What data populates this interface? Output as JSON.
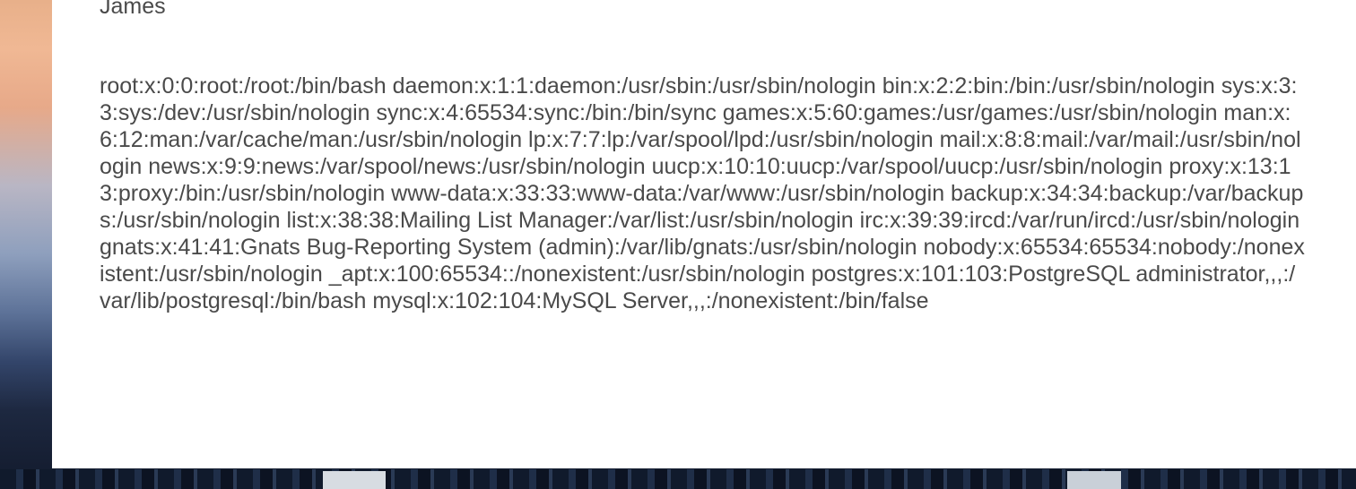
{
  "author_name": "James",
  "comment_body": "root:x:0:0:root:/root:/bin/bash daemon:x:1:1:daemon:/usr/sbin:/usr/sbin/nologin bin:x:2:2:bin:/bin:/usr/sbin/nologin sys:x:3:3:sys:/dev:/usr/sbin/nologin sync:x:4:65534:sync:/bin:/bin/sync games:x:5:60:games:/usr/games:/usr/sbin/nologin man:x:6:12:man:/var/cache/man:/usr/sbin/nologin lp:x:7:7:lp:/var/spool/lpd:/usr/sbin/nologin mail:x:8:8:mail:/var/mail:/usr/sbin/nologin news:x:9:9:news:/var/spool/news:/usr/sbin/nologin uucp:x:10:10:uucp:/var/spool/uucp:/usr/sbin/nologin proxy:x:13:13:proxy:/bin:/usr/sbin/nologin www-data:x:33:33:www-data:/var/www:/usr/sbin/nologin backup:x:34:34:backup:/var/backups:/usr/sbin/nologin list:x:38:38:Mailing List Manager:/var/list:/usr/sbin/nologin irc:x:39:39:ircd:/var/run/ircd:/usr/sbin/nologin gnats:x:41:41:Gnats Bug-Reporting System (admin):/var/lib/gnats:/usr/sbin/nologin nobody:x:65534:65534:nobody:/nonexistent:/usr/sbin/nologin _apt:x:100:65534::/nonexistent:/usr/sbin/nologin postgres:x:101:103:PostgreSQL administrator,,,:/var/lib/postgresql:/bin/bash mysql:x:102:104:MySQL Server,,,:/nonexistent:/bin/false"
}
